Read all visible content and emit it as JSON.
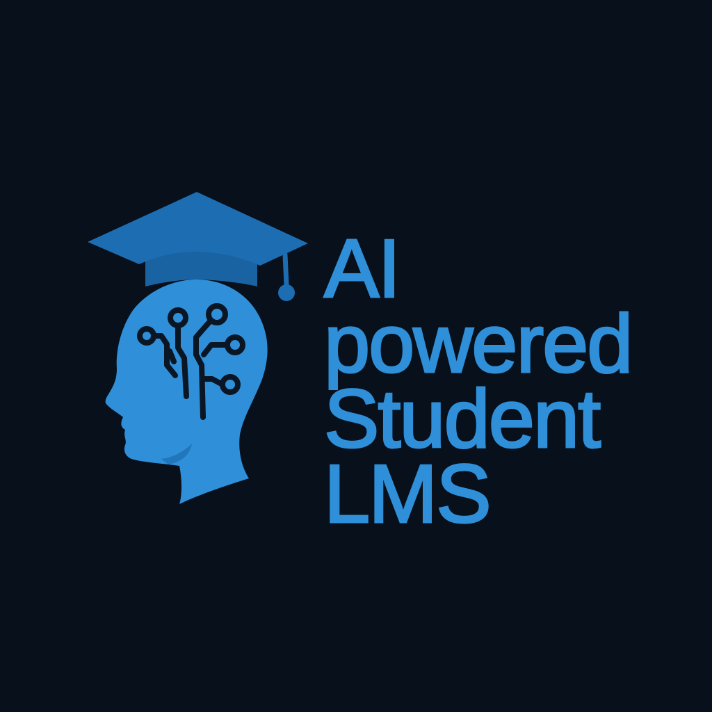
{
  "brand": {
    "lines": [
      "AI",
      "powered",
      "Student",
      "LMS"
    ]
  },
  "icons": {
    "logo": "graduation-cap-head-circuit-icon",
    "cap": "graduation-cap-icon",
    "head": "human-head-profile-icon",
    "circuit": "circuit-brain-icon"
  },
  "colors": {
    "background": "#07101b",
    "text": "#2f8fd8",
    "head": "#2f8fd8",
    "head_shadow": "#1f6fb2",
    "cap": "#1d6db3",
    "cap_band": "#1a63a3",
    "circuit": "#0b1624"
  }
}
